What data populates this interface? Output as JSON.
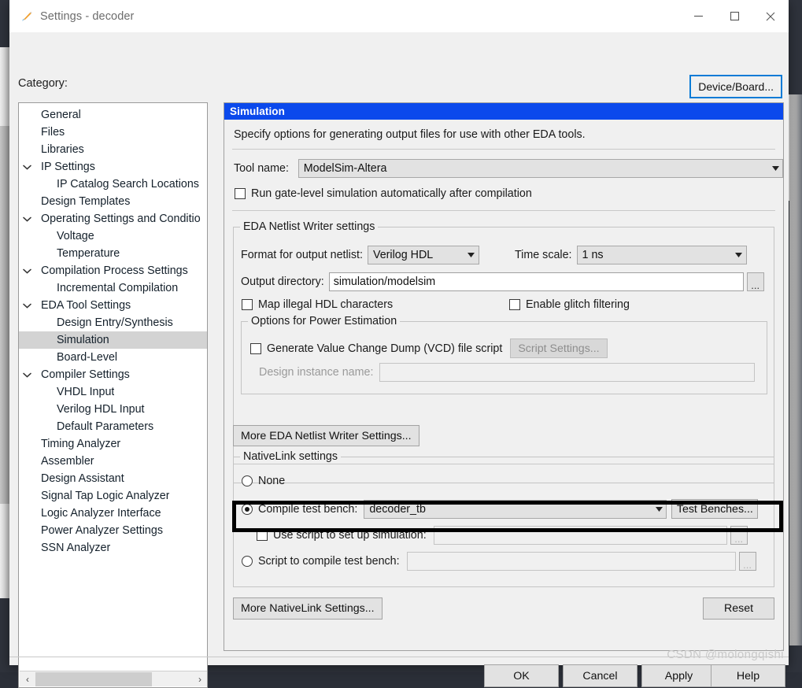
{
  "window": {
    "title": "Settings - decoder",
    "icon": "pencil-icon",
    "minimize_label": "–",
    "maximize_label": "☐",
    "close_label": "✕"
  },
  "header": {
    "category_label": "Category:",
    "device_board_button": "Device/Board..."
  },
  "tree": {
    "items": [
      {
        "label": "General",
        "level": 0,
        "expandable": false,
        "selected": false
      },
      {
        "label": "Files",
        "level": 0,
        "expandable": false,
        "selected": false
      },
      {
        "label": "Libraries",
        "level": 0,
        "expandable": false,
        "selected": false
      },
      {
        "label": "IP Settings",
        "level": 0,
        "expandable": true,
        "selected": false
      },
      {
        "label": "IP Catalog Search Locations",
        "level": 1,
        "expandable": false,
        "selected": false
      },
      {
        "label": "Design Templates",
        "level": 0,
        "expandable": false,
        "selected": false
      },
      {
        "label": "Operating Settings and Conditio",
        "level": 0,
        "expandable": true,
        "selected": false
      },
      {
        "label": "Voltage",
        "level": 1,
        "expandable": false,
        "selected": false
      },
      {
        "label": "Temperature",
        "level": 1,
        "expandable": false,
        "selected": false
      },
      {
        "label": "Compilation Process Settings",
        "level": 0,
        "expandable": true,
        "selected": false
      },
      {
        "label": "Incremental Compilation",
        "level": 1,
        "expandable": false,
        "selected": false
      },
      {
        "label": "EDA Tool Settings",
        "level": 0,
        "expandable": true,
        "selected": false
      },
      {
        "label": "Design Entry/Synthesis",
        "level": 1,
        "expandable": false,
        "selected": false
      },
      {
        "label": "Simulation",
        "level": 1,
        "expandable": false,
        "selected": true
      },
      {
        "label": "Board-Level",
        "level": 1,
        "expandable": false,
        "selected": false
      },
      {
        "label": "Compiler Settings",
        "level": 0,
        "expandable": true,
        "selected": false
      },
      {
        "label": "VHDL Input",
        "level": 1,
        "expandable": false,
        "selected": false
      },
      {
        "label": "Verilog HDL Input",
        "level": 1,
        "expandable": false,
        "selected": false
      },
      {
        "label": "Default Parameters",
        "level": 1,
        "expandable": false,
        "selected": false
      },
      {
        "label": "Timing Analyzer",
        "level": 0,
        "expandable": false,
        "selected": false
      },
      {
        "label": "Assembler",
        "level": 0,
        "expandable": false,
        "selected": false
      },
      {
        "label": "Design Assistant",
        "level": 0,
        "expandable": false,
        "selected": false
      },
      {
        "label": "Signal Tap Logic Analyzer",
        "level": 0,
        "expandable": false,
        "selected": false
      },
      {
        "label": "Logic Analyzer Interface",
        "level": 0,
        "expandable": false,
        "selected": false
      },
      {
        "label": "Power Analyzer Settings",
        "level": 0,
        "expandable": false,
        "selected": false
      },
      {
        "label": "SSN Analyzer",
        "level": 0,
        "expandable": false,
        "selected": false
      }
    ],
    "scroll_left_arrow": "‹",
    "scroll_right_arrow": "›"
  },
  "pane": {
    "title": "Simulation",
    "description": "Specify options for generating output files for use with other EDA tools.",
    "tool_name_label": "Tool name:",
    "tool_name_value": "ModelSim-Altera",
    "run_gate_level_label": "Run gate-level simulation automatically after compilation",
    "run_gate_level_checked": false
  },
  "netlist": {
    "legend": "EDA Netlist Writer settings",
    "format_label": "Format for output netlist:",
    "format_value": "Verilog HDL",
    "time_scale_label": "Time scale:",
    "time_scale_value": "1 ns",
    "output_dir_label": "Output directory:",
    "output_dir_value": "simulation/modelsim",
    "browse_label": "...",
    "map_illegal_label": "Map illegal HDL characters",
    "map_illegal_checked": false,
    "glitch_label": "Enable glitch filtering",
    "glitch_checked": false,
    "power": {
      "legend": "Options for Power Estimation",
      "vcd_label": "Generate Value Change Dump (VCD) file script",
      "vcd_checked": false,
      "script_settings_button": "Script Settings...",
      "design_instance_label": "Design instance name:",
      "design_instance_value": ""
    },
    "more_button": "More EDA Netlist Writer Settings..."
  },
  "nativelink": {
    "legend": "NativeLink settings",
    "option_none_label": "None",
    "option_none_selected": false,
    "option_compile_label": "Compile test bench:",
    "option_compile_selected": true,
    "compile_value": "decoder_tb",
    "test_benches_button": "Test Benches...",
    "use_script_label": "Use script to set up simulation:",
    "use_script_checked": false,
    "use_script_value": "",
    "use_script_browse": "...",
    "option_script_label": "Script to compile test bench:",
    "option_script_selected": false,
    "script_value": "",
    "script_browse": "...",
    "more_button": "More NativeLink Settings...",
    "reset_button": "Reset"
  },
  "footer": {
    "ok": "OK",
    "cancel": "Cancel",
    "apply": "Apply",
    "help": "Help"
  },
  "watermark": "CSDN @molongqishi",
  "colors": {
    "pane_title_bg": "#0b49ec",
    "focus_border": "#0a7bd6",
    "tree_selection": "#d3d3d3",
    "annotation": "#000000"
  }
}
